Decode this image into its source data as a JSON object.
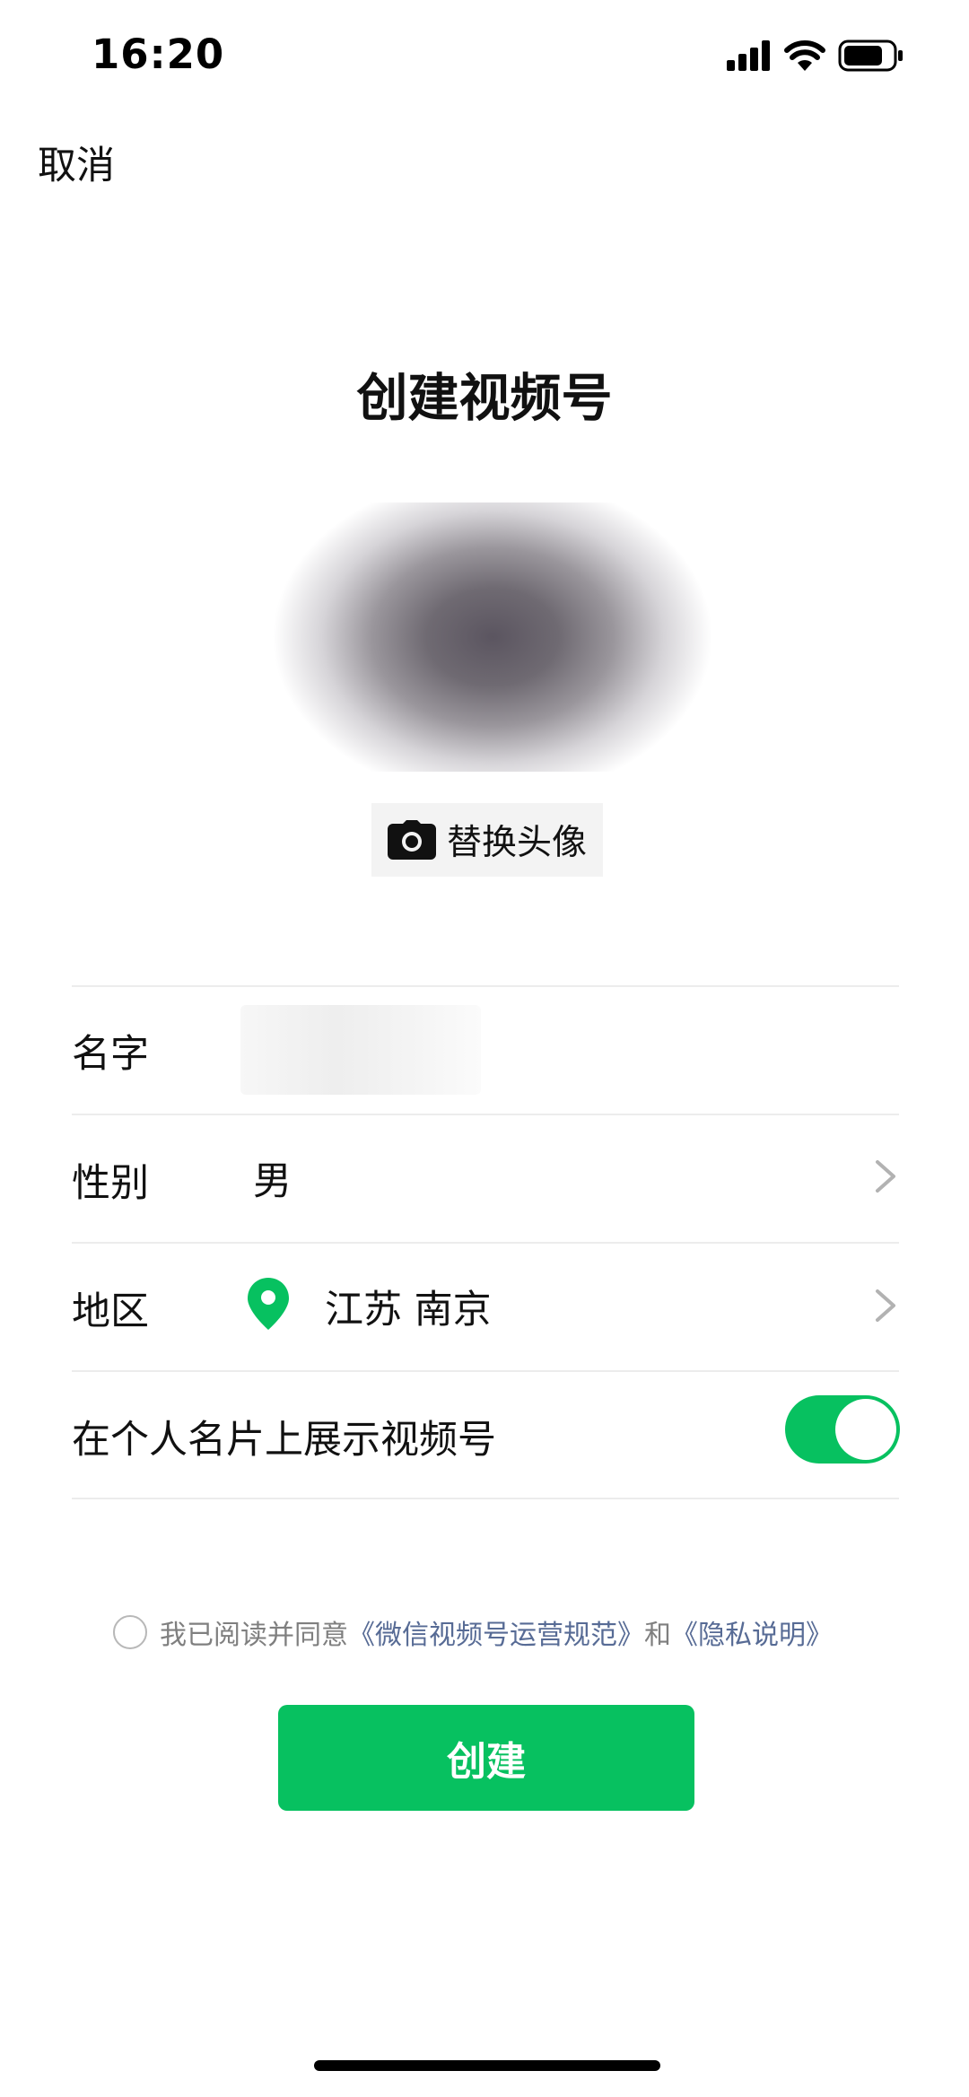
{
  "status_bar": {
    "time": "16:20"
  },
  "nav": {
    "cancel_label": "取消"
  },
  "page_title": "创建视频号",
  "avatar": {
    "replace_label": "替换头像"
  },
  "form": {
    "name_label": "名字",
    "gender_label": "性别",
    "gender_value": "男",
    "region_label": "地区",
    "region_value": "江苏 南京",
    "show_on_card_label": "在个人名片上展示视频号",
    "show_on_card_enabled": true
  },
  "agreement": {
    "prefix": "我已阅读并同意",
    "link1": "《微信视频号运营规范》",
    "middle": "和",
    "link2": "《隐私说明》",
    "checked": false
  },
  "create_button_label": "创建",
  "colors": {
    "accent": "#07c160",
    "link": "#576b95"
  }
}
